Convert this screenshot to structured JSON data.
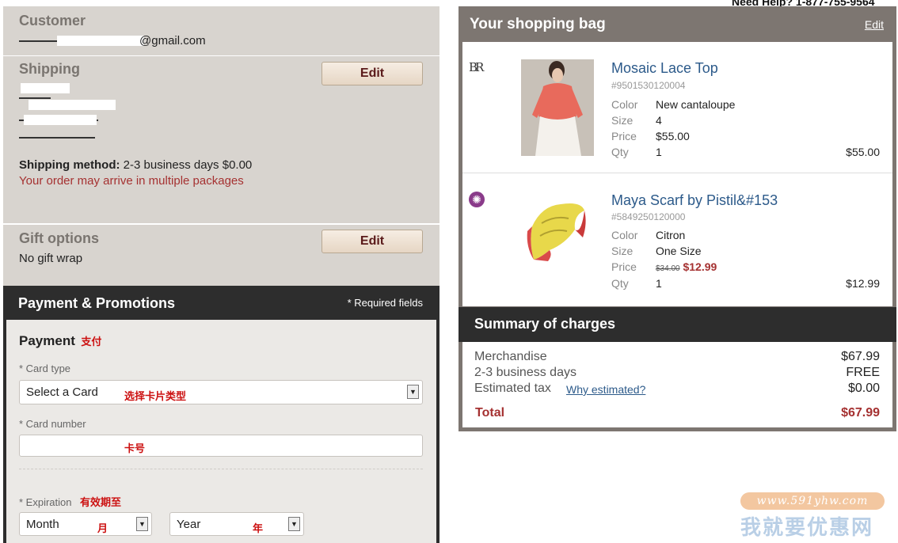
{
  "help": {
    "text": "Need Help? 1-877-755-9564"
  },
  "customer": {
    "title": "Customer",
    "email_suffix": "@gmail.com"
  },
  "shipping": {
    "title": "Shipping",
    "edit_label": "Edit",
    "method_label": "Shipping method:",
    "method_value": "2-3 business days $0.00",
    "notice": "Your order may arrive in multiple packages"
  },
  "gift": {
    "title": "Gift options",
    "edit_label": "Edit",
    "value": "No gift wrap"
  },
  "payment_promotions": {
    "title": "Payment & Promotions",
    "required_note": "* Required fields"
  },
  "payment": {
    "title": "Payment",
    "title_cn": "支付",
    "card_type_label": "* Card type",
    "card_type_value": "Select a Card",
    "card_type_cn": "选择卡片类型",
    "card_number_label": "* Card number",
    "card_number_cn": "卡号",
    "expiration_label": "* Expiration",
    "expiration_cn": "有效期至",
    "month_value": "Month",
    "month_cn": "月",
    "year_value": "Year",
    "year_cn": "年"
  },
  "bag": {
    "title": "Your shopping bag",
    "edit_label": "Edit",
    "items": [
      {
        "brand_mark": "BR",
        "name": "Mosaic Lace Top",
        "sku": "#9501530120004",
        "attrs": [
          {
            "k": "Color",
            "v": "New cantaloupe"
          },
          {
            "k": "Size",
            "v": "4"
          },
          {
            "k": "Price",
            "v": "$55.00"
          },
          {
            "k": "Qty",
            "v": "1"
          }
        ],
        "total": "$55.00"
      },
      {
        "brand_mark": "✺",
        "name": "Maya Scarf by Pistil&#153",
        "sku": "#5849250120000",
        "attrs": [
          {
            "k": "Color",
            "v": "Citron"
          },
          {
            "k": "Size",
            "v": "One Size"
          },
          {
            "k": "Price",
            "v": ""
          },
          {
            "k": "Qty",
            "v": "1"
          }
        ],
        "price_old": "$34.00",
        "price_new": "$12.99",
        "total": "$12.99"
      }
    ]
  },
  "summary": {
    "title": "Summary of charges",
    "rows": [
      {
        "k": "Merchandise",
        "v": "$67.99"
      },
      {
        "k": "2-3 business days",
        "v": "FREE"
      },
      {
        "k": "Estimated tax",
        "v": "$0.00",
        "link": "Why estimated?"
      }
    ],
    "total_label": "Total",
    "total_value": "$67.99"
  },
  "watermark": {
    "url": "www.591yhw.com",
    "text": "我就要优惠网"
  },
  "colors": {
    "accent_red": "#a53131",
    "link_blue": "#2c5a8a",
    "dark_header": "#2d2d2d",
    "panel_beige": "#d8d4cf"
  }
}
